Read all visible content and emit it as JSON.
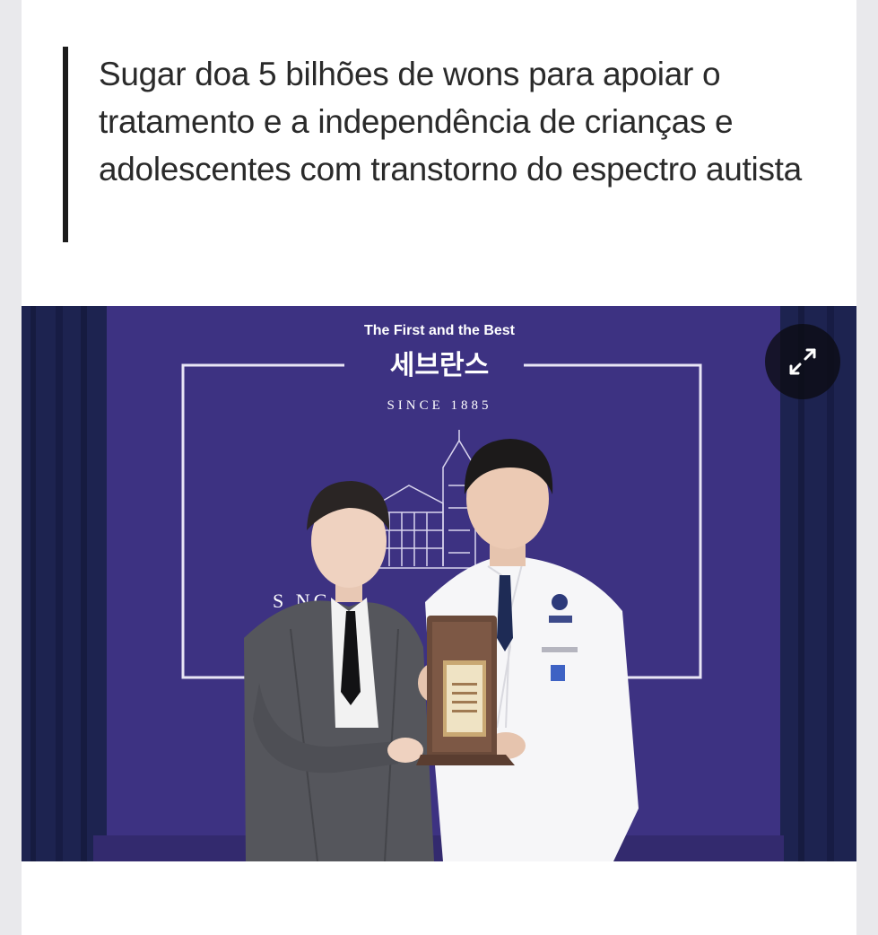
{
  "article": {
    "headline": "Sugar doa 5 bilhões de wons para apoiar o tratamento e a independência de crianças e adolescentes com transtorno do espectro autista"
  },
  "photo": {
    "backdrop_tagline": "The First and the Best",
    "backdrop_brand": "세브란스",
    "backdrop_since": "SINCE 1885",
    "backdrop_partial": "S     NC",
    "expand_icon": "expand-arrows-icon"
  },
  "colors": {
    "backdrop": "#3b2f79",
    "curtain": "#1f2450",
    "headline_bar": "#1c1c1c",
    "page_bg": "#e9e9ec"
  }
}
